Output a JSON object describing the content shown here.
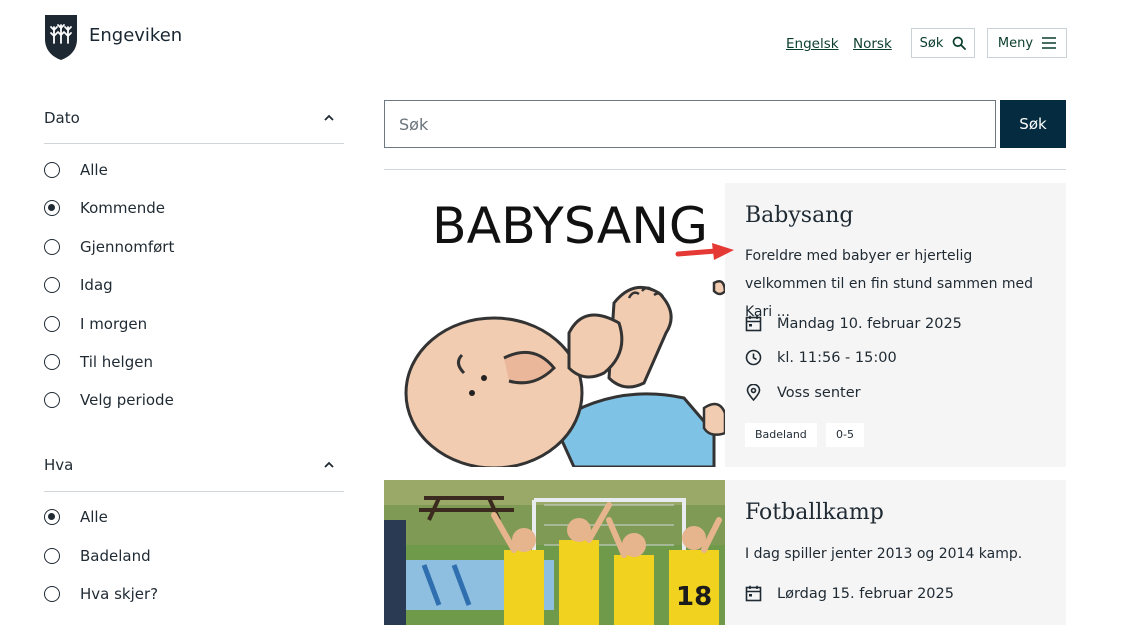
{
  "header": {
    "site_name": "Engeviken",
    "lang_english": "Engelsk",
    "lang_norsk": "Norsk",
    "search_label": "Søk",
    "menu_label": "Meny"
  },
  "filters": {
    "date": {
      "heading": "Dato",
      "options": [
        {
          "label": "Alle",
          "selected": false
        },
        {
          "label": "Kommende",
          "selected": true
        },
        {
          "label": "Gjennomført",
          "selected": false
        },
        {
          "label": "Idag",
          "selected": false
        },
        {
          "label": "I morgen",
          "selected": false
        },
        {
          "label": "Til helgen",
          "selected": false
        },
        {
          "label": "Velg periode",
          "selected": false
        }
      ]
    },
    "what": {
      "heading": "Hva",
      "options": [
        {
          "label": "Alle",
          "selected": true
        },
        {
          "label": "Badeland",
          "selected": false
        },
        {
          "label": "Hva skjer?",
          "selected": false
        }
      ]
    }
  },
  "search": {
    "placeholder": "Søk",
    "button_label": "Søk"
  },
  "events": [
    {
      "title": "Babysang",
      "image_text": "BABYSANG",
      "description": "Foreldre med babyer er hjertelig velkommen til en fin stund sammen med Kari ...",
      "date": "Mandag 10. februar 2025",
      "time": "kl. 11:56 - 15:00",
      "location": "Voss senter",
      "tags": [
        "Badeland",
        "0-5"
      ]
    },
    {
      "title": "Fotballkamp",
      "description": "I dag spiller jenter 2013 og 2014 kamp.",
      "date": "Lørdag 15. februar 2025",
      "jersey_number": "18"
    }
  ],
  "colors": {
    "accent": "#042b40",
    "link": "#0b3d2e",
    "card_bg": "#f5f5f5",
    "annotation_arrow": "#e53935"
  }
}
